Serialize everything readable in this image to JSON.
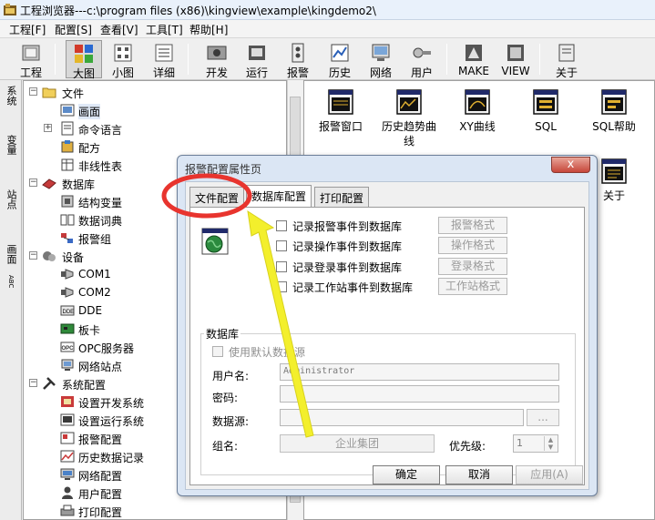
{
  "window": {
    "title": "工程浏览器---c:\\program files (x86)\\kingview\\example\\kingdemo2\\"
  },
  "menu": [
    "工程[F]",
    "配置[S]",
    "查看[V]",
    "工具[T]",
    "帮助[H]"
  ],
  "toolbar": {
    "buttons": [
      {
        "label": "工程",
        "icon": "project-icon"
      },
      {
        "label": "大图",
        "icon": "large-icons-icon"
      },
      {
        "label": "小图",
        "icon": "small-icons-icon"
      },
      {
        "label": "详细",
        "icon": "details-icon"
      },
      {
        "label": "开发",
        "icon": "develop-icon"
      },
      {
        "label": "运行",
        "icon": "run-icon"
      },
      {
        "label": "报警",
        "icon": "alarm-icon"
      },
      {
        "label": "历史",
        "icon": "history-icon"
      },
      {
        "label": "网络",
        "icon": "network-icon"
      },
      {
        "label": "用户",
        "icon": "user-icon"
      },
      {
        "label": "MAKE",
        "icon": "make-icon"
      },
      {
        "label": "VIEW",
        "icon": "view-icon"
      },
      {
        "label": "关于",
        "icon": "about-icon"
      }
    ]
  },
  "side_tabs": [
    "系统",
    "变量",
    "站点",
    "画面",
    "ABC"
  ],
  "tree": {
    "items": [
      {
        "label": "文件",
        "level": 0
      },
      {
        "label": "画面",
        "level": 1
      },
      {
        "label": "命令语言",
        "level": 1
      },
      {
        "label": "配方",
        "level": 1
      },
      {
        "label": "非线性表",
        "level": 1
      },
      {
        "label": "数据库",
        "level": 0
      },
      {
        "label": "结构变量",
        "level": 1
      },
      {
        "label": "数据词典",
        "level": 1
      },
      {
        "label": "报警组",
        "level": 1
      },
      {
        "label": "设备",
        "level": 0
      },
      {
        "label": "COM1",
        "level": 1
      },
      {
        "label": "COM2",
        "level": 1
      },
      {
        "label": "DDE",
        "level": 1
      },
      {
        "label": "板卡",
        "level": 1
      },
      {
        "label": "OPC服务器",
        "level": 1
      },
      {
        "label": "网络站点",
        "level": 1
      },
      {
        "label": "系统配置",
        "level": 0
      },
      {
        "label": "设置开发系统",
        "level": 1
      },
      {
        "label": "设置运行系统",
        "level": 1
      },
      {
        "label": "报警配置",
        "level": 1
      },
      {
        "label": "历史数据记录",
        "level": 1
      },
      {
        "label": "网络配置",
        "level": 1
      },
      {
        "label": "用户配置",
        "level": 1
      },
      {
        "label": "打印配置",
        "level": 1
      }
    ]
  },
  "content_icons": [
    {
      "label": "报警窗口"
    },
    {
      "label": "历史趋势曲线"
    },
    {
      "label": "XY曲线"
    },
    {
      "label": "SQL"
    },
    {
      "label": "SQL帮助"
    },
    {
      "label": "关于"
    }
  ],
  "dialog": {
    "title": "报警配置属性页",
    "close": "x",
    "tabs": [
      "文件配置",
      "数据库配置",
      "打印配置"
    ],
    "checkboxes": [
      {
        "label": "记录报警事件到数据库",
        "button": "报警格式"
      },
      {
        "label": "记录操作事件到数据库",
        "button": "操作格式"
      },
      {
        "label": "记录登录事件到数据库",
        "button": "登录格式"
      },
      {
        "label": "记录工作站事件到数据库",
        "button": "工作站格式"
      }
    ],
    "database": {
      "group_title": "数据库",
      "use_default": "使用默认数据源",
      "username_label": "用户名:",
      "username_value": "Administrator",
      "password_label": "密码:",
      "datasource_label": "数据源:",
      "browse": "...",
      "groupname_label": "组名:",
      "groupname_value": "企业集团",
      "priority_label": "优先级:",
      "priority_value": "1"
    },
    "buttons": {
      "ok": "确定",
      "cancel": "取消",
      "apply": "应用(A)"
    }
  },
  "colors": {
    "annotation_circle": "#e8342e",
    "annotation_arrow": "#f3ef2c"
  }
}
